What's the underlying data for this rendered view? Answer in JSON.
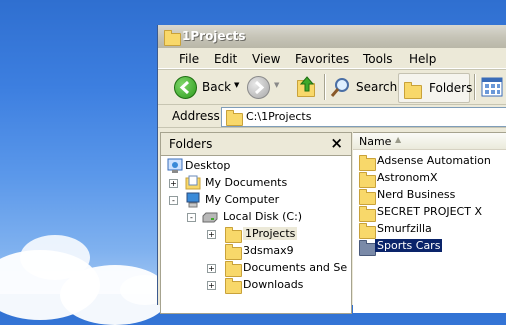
{
  "window": {
    "title": "1Projects"
  },
  "menu": [
    "File",
    "Edit",
    "View",
    "Favorites",
    "Tools",
    "Help"
  ],
  "toolbar": {
    "back_label": "Back",
    "search_label": "Search",
    "folders_label": "Folders"
  },
  "address": {
    "label": "Address",
    "value": "C:\\1Projects"
  },
  "folders_pane": {
    "title": "Folders",
    "close_glyph": "×",
    "tree": [
      {
        "label": "Desktop",
        "expander": ""
      },
      {
        "label": "My Documents",
        "expander": "+"
      },
      {
        "label": "My Computer",
        "expander": "-"
      },
      {
        "label": "Local Disk (C:)",
        "expander": "-"
      },
      {
        "label": "1Projects",
        "expander": "+"
      },
      {
        "label": "3dsmax9",
        "expander": ""
      },
      {
        "label": "Documents and Se",
        "expander": "+"
      },
      {
        "label": "Downloads",
        "expander": "+"
      }
    ]
  },
  "list_pane": {
    "column_name": "Name",
    "items": [
      "Adsense Automation",
      "AstronomX",
      "Nerd Business",
      "SECRET PROJECT X",
      "Smurfzilla",
      "Sports Cars"
    ],
    "selected_index": 5
  }
}
